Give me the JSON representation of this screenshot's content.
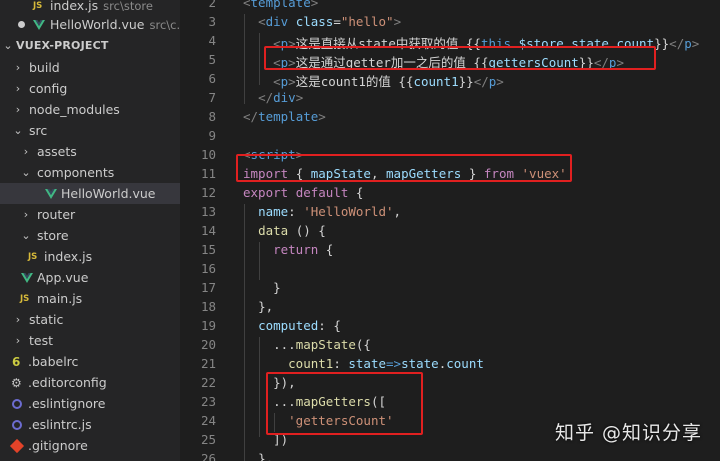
{
  "sidebar": {
    "items": [
      {
        "label": "index.js",
        "detail": "src\\store",
        "icon": "js-file-icon"
      },
      {
        "label": "HelloWorld.vue",
        "detail": "src\\c...",
        "icon": "vue-file-icon"
      },
      {
        "label": "VUEX-PROJECT"
      },
      {
        "label": "build"
      },
      {
        "label": "config"
      },
      {
        "label": "node_modules"
      },
      {
        "label": "src"
      },
      {
        "label": "assets"
      },
      {
        "label": "components"
      },
      {
        "label": "HelloWorld.vue"
      },
      {
        "label": "router"
      },
      {
        "label": "store"
      },
      {
        "label": "index.js"
      },
      {
        "label": "App.vue"
      },
      {
        "label": "main.js"
      },
      {
        "label": "static"
      },
      {
        "label": "test"
      },
      {
        "label": ".babelrc"
      },
      {
        "label": ".editorconfig"
      },
      {
        "label": ".eslintignore"
      },
      {
        "label": ".eslintrc.js"
      },
      {
        "label": ".gitignore"
      }
    ],
    "js_icon_text": "JS"
  },
  "editor": {
    "line_numbers": [
      "2",
      "3",
      "4",
      "5",
      "6",
      "7",
      "8",
      "9",
      "10",
      "11",
      "12",
      "13",
      "14",
      "15",
      "16",
      "17",
      "18",
      "19",
      "20",
      "21",
      "22",
      "23",
      "24",
      "25",
      "26"
    ]
  },
  "watermark": "知乎 @知识分享"
}
